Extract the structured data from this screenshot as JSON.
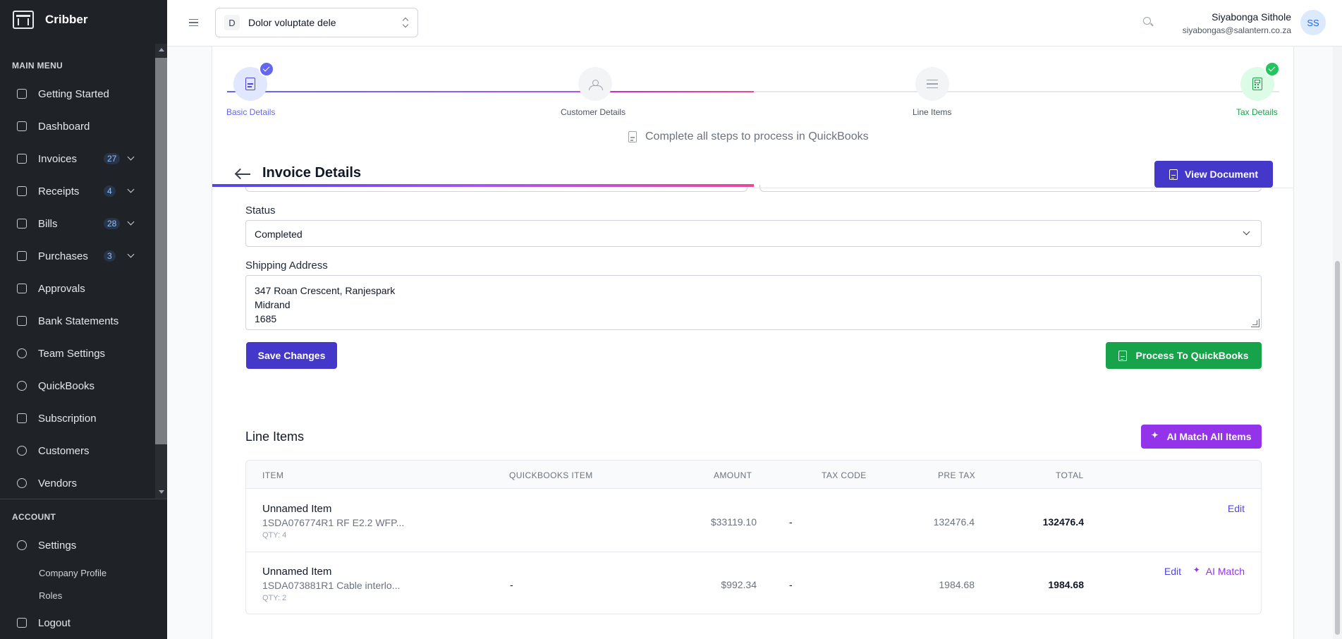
{
  "sidebar": {
    "brand": "Cribber",
    "main_menu_title": "MAIN MENU",
    "items": [
      {
        "label": "Getting Started"
      },
      {
        "label": "Dashboard"
      },
      {
        "label": "Invoices",
        "badge": "27"
      },
      {
        "label": "Receipts",
        "badge": "4"
      },
      {
        "label": "Bills",
        "badge": "28"
      },
      {
        "label": "Purchases",
        "badge": "3"
      },
      {
        "label": "Approvals"
      },
      {
        "label": "Bank Statements"
      },
      {
        "label": "Team Settings"
      },
      {
        "label": "QuickBooks"
      },
      {
        "label": "Subscription"
      },
      {
        "label": "Customers"
      },
      {
        "label": "Vendors"
      }
    ],
    "account_title": "ACCOUNT",
    "settings_label": "Settings",
    "sub_items": [
      "Company Profile",
      "Roles"
    ],
    "logout_label": "Logout"
  },
  "topbar": {
    "company_initial": "D",
    "company_name": "Dolor voluptate dele",
    "user_name": "Siyabonga Sithole",
    "user_email": "siyabongas@salantern.co.za",
    "avatar_initials": "SS"
  },
  "stepper": {
    "steps": [
      {
        "label": "Basic Details",
        "state": "complete"
      },
      {
        "label": "Customer Details",
        "state": "pending"
      },
      {
        "label": "Line Items",
        "state": "pending"
      },
      {
        "label": "Tax Details",
        "state": "complete"
      }
    ],
    "note": "Complete all steps to process in QuickBooks"
  },
  "invoice": {
    "title": "Invoice Details",
    "view_document_label": "View Document",
    "status_label": "Status",
    "status_value": "Completed",
    "shipping_label": "Shipping Address",
    "shipping_lines": [
      "347 Roan Crescent, Ranjespark",
      "Midrand",
      "1685"
    ],
    "save_label": "Save Changes",
    "process_label": "Process To QuickBooks"
  },
  "line_items": {
    "title": "Line Items",
    "ai_match_all_label": "AI Match All Items",
    "columns": [
      "ITEM",
      "QUICKBOOKS ITEM",
      "AMOUNT",
      "TAX CODE",
      "PRE TAX",
      "TOTAL"
    ],
    "rows": [
      {
        "name": "Unnamed Item",
        "desc": "1SDA076774R1 RF E2.2 WFP...",
        "qty": "QTY: 4",
        "qb_item": "",
        "amount": "$33119.10",
        "tax_code": "-",
        "pre_tax": "132476.4",
        "total": "132476.4",
        "edit": "Edit",
        "ai_match": ""
      },
      {
        "name": "Unnamed Item",
        "desc": "1SDA073881R1 Cable interlo...",
        "qty": "QTY: 2",
        "qb_item": "-",
        "amount": "$992.34",
        "tax_code": "-",
        "pre_tax": "1984.68",
        "total": "1984.68",
        "edit": "Edit",
        "ai_match": "AI Match"
      }
    ]
  },
  "colors": {
    "primary": "#4338ca",
    "success": "#16a34a",
    "ai": "#9333ea",
    "sidebar_bg": "#1f2226"
  }
}
